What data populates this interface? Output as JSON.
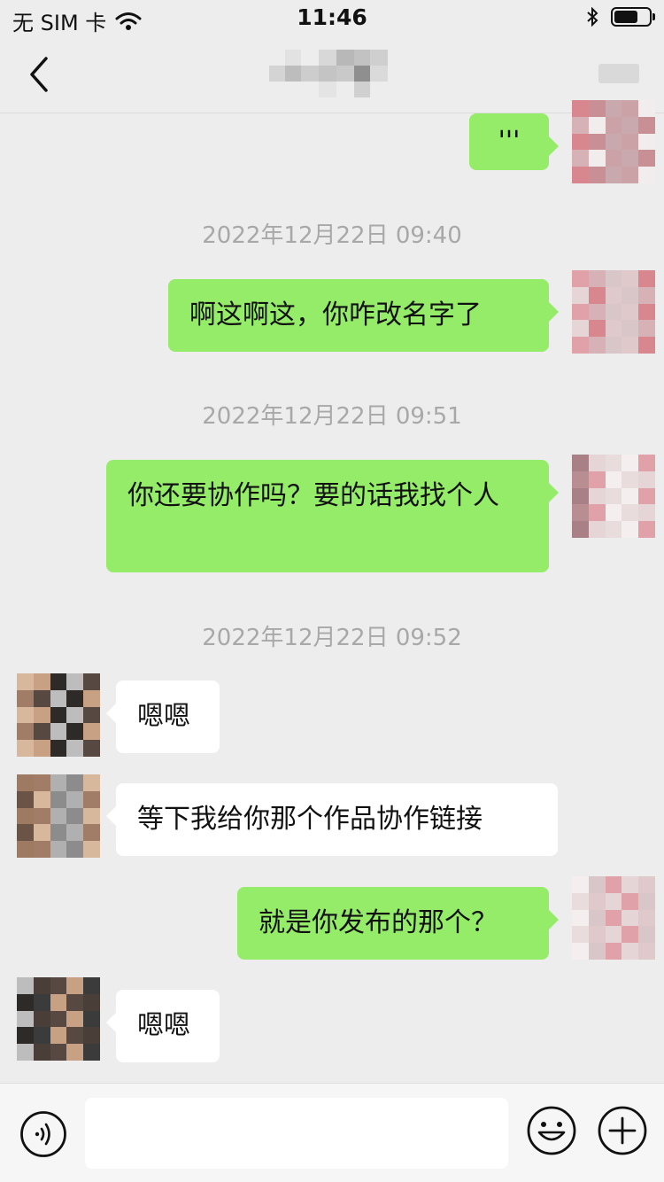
{
  "status_bar": {
    "carrier": "无 SIM 卡",
    "time": "11:46",
    "battery_level": 0.7
  },
  "nav": {
    "icons": {
      "back": "chevron-left-icon",
      "more": "more-icon"
    }
  },
  "messages": [
    {
      "type": "message",
      "side": "me",
      "text": "'''"
    },
    {
      "type": "time",
      "text": "2022年12月22日 09:40"
    },
    {
      "type": "message",
      "side": "me",
      "text": "啊这啊这，你咋改名字了"
    },
    {
      "type": "time",
      "text": "2022年12月22日 09:51"
    },
    {
      "type": "message",
      "side": "me",
      "text": "你还要协作吗？要的话我找个人"
    },
    {
      "type": "time",
      "text": "2022年12月22日 09:52"
    },
    {
      "type": "message",
      "side": "them",
      "text": "嗯嗯"
    },
    {
      "type": "message",
      "side": "them",
      "text": "等下我给你那个作品协作链接"
    },
    {
      "type": "message",
      "side": "me",
      "text": "就是你发布的那个？"
    },
    {
      "type": "message",
      "side": "them",
      "text": "嗯嗯"
    }
  ],
  "input_bar": {
    "placeholder": "",
    "icons": {
      "voice": "voice-icon",
      "emoji": "emoji-icon",
      "more": "plus-icon"
    }
  },
  "colors": {
    "background": "#ededed",
    "my_bubble": "#95ec69",
    "their_bubble": "#ffffff",
    "timestamp": "#a8a8a8"
  }
}
